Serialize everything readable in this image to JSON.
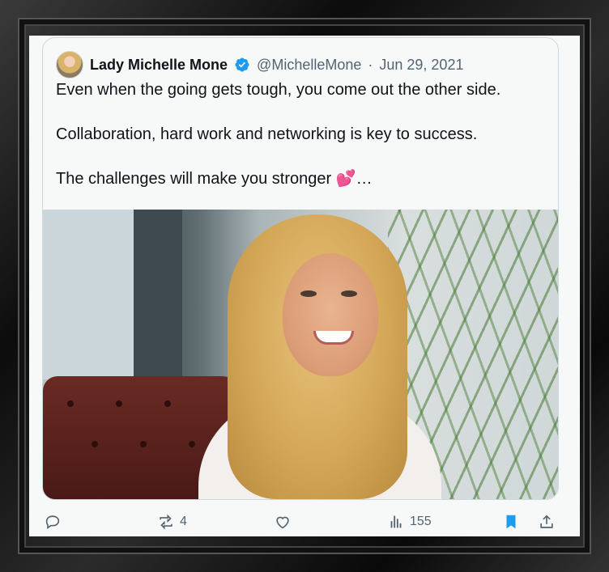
{
  "tweet": {
    "author_name": "Lady Michelle Mone",
    "handle": "@MichelleMone",
    "separator": "·",
    "date": "Jun 29, 2021",
    "paragraphs": [
      "Even when the going gets tough, you come out the other side.",
      "Collaboration, hard work and networking is key to success.",
      "The challenges will make you stronger"
    ],
    "trailing": "…",
    "emoji": "💕"
  },
  "actions": {
    "reply_count": "",
    "retweet_count": "4",
    "like_count": "",
    "views_count": "155"
  },
  "icons": {
    "verified": "verified-badge-icon",
    "reply": "reply-icon",
    "retweet": "retweet-icon",
    "like": "heart-icon",
    "views": "views-icon",
    "bookmark": "bookmark-icon",
    "share": "share-icon"
  },
  "colors": {
    "accent": "#1d9bf0",
    "text": "#0f1419",
    "muted": "#536471",
    "card_bg": "#f7f9f9"
  }
}
